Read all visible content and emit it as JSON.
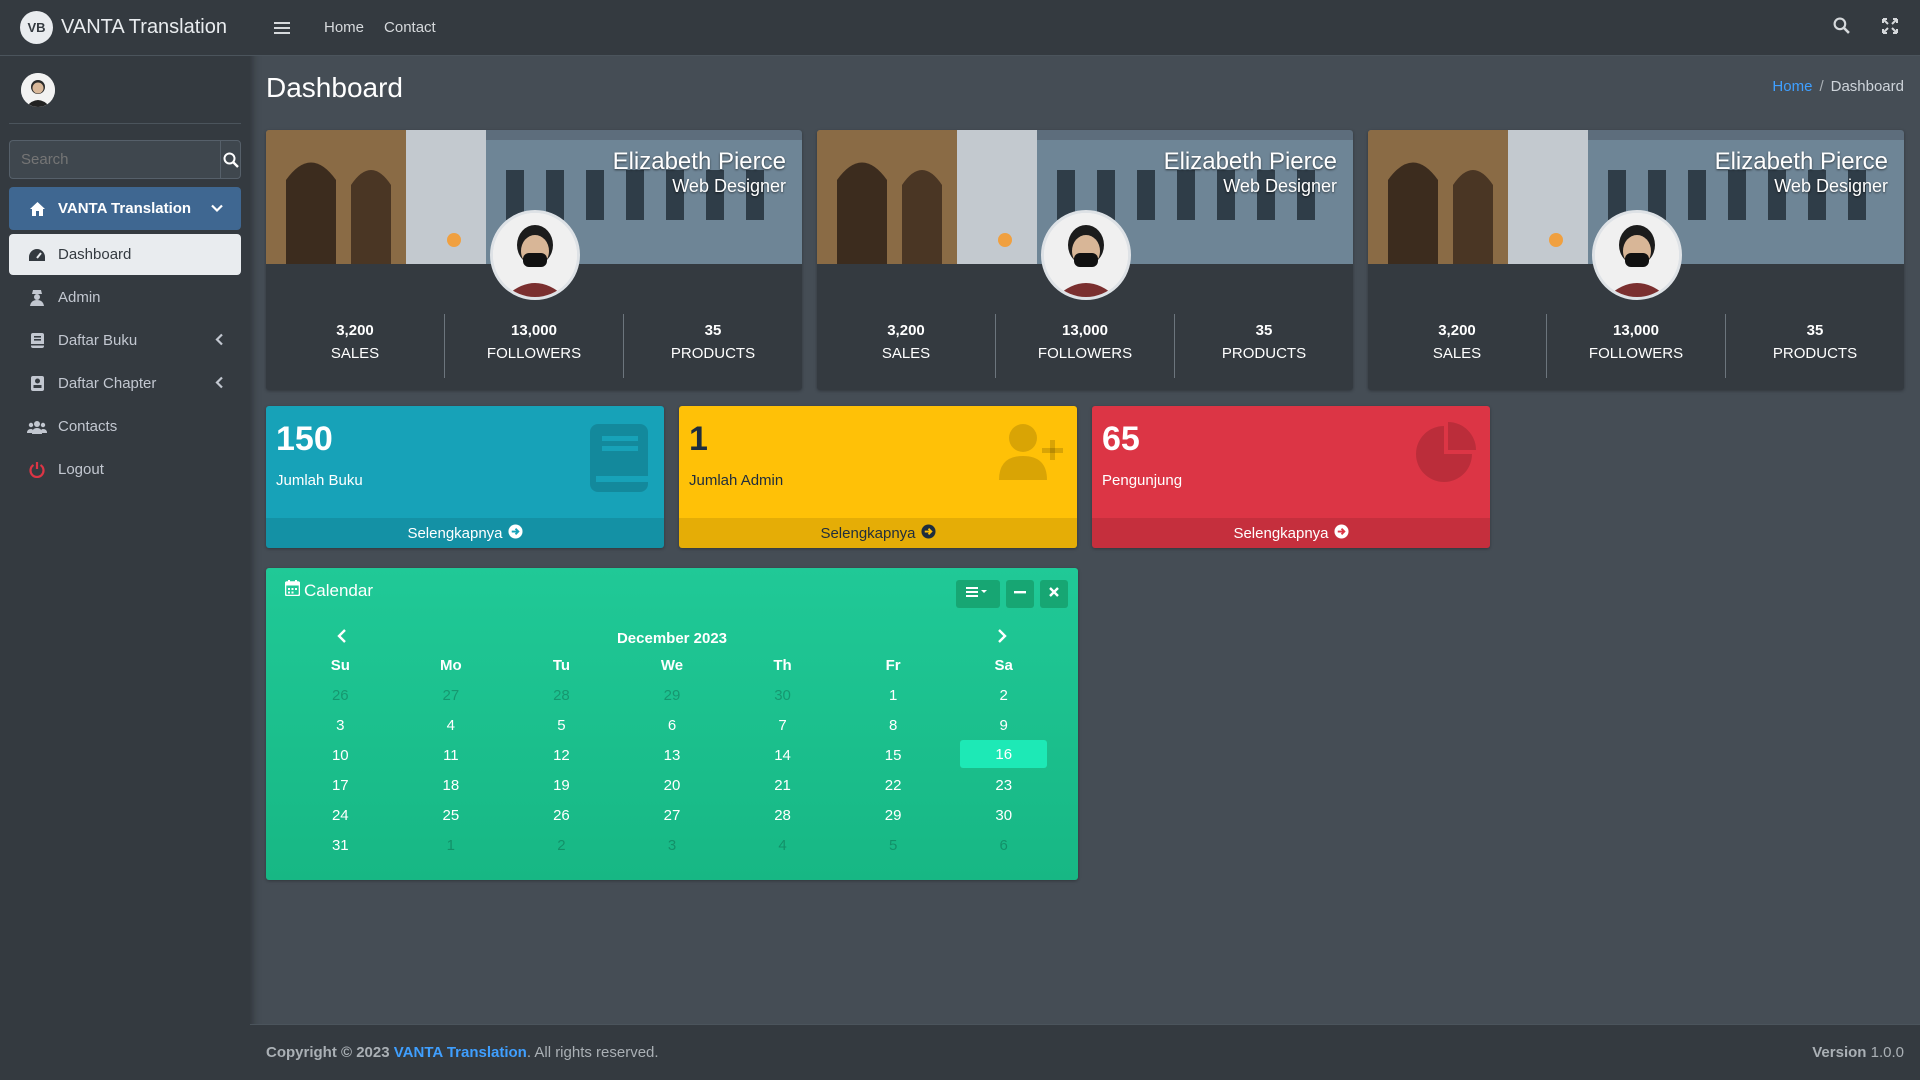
{
  "brand": {
    "logo_text": "VB",
    "name": "VANTA Translation"
  },
  "search": {
    "placeholder": "Search"
  },
  "sidebar": {
    "items": [
      {
        "label": "VANTA Translation",
        "icon": "home-icon"
      },
      {
        "label": "Dashboard",
        "icon": "dashboard-icon"
      },
      {
        "label": "Admin",
        "icon": "user-secret-icon"
      },
      {
        "label": "Daftar Buku",
        "icon": "book-icon"
      },
      {
        "label": "Daftar Chapter",
        "icon": "book-reader-icon"
      },
      {
        "label": "Contacts",
        "icon": "users-icon"
      },
      {
        "label": "Logout",
        "icon": "power-icon"
      }
    ]
  },
  "topnav": {
    "home": "Home",
    "contact": "Contact"
  },
  "header": {
    "title": "Dashboard",
    "breadcrumb_home": "Home",
    "breadcrumb_sep": "/",
    "breadcrumb_current": "Dashboard"
  },
  "profiles": [
    {
      "name": "Elizabeth Pierce",
      "role": "Web Designer",
      "stats": [
        {
          "num": "3,200",
          "label": "SALES"
        },
        {
          "num": "13,000",
          "label": "FOLLOWERS"
        },
        {
          "num": "35",
          "label": "PRODUCTS"
        }
      ]
    },
    {
      "name": "Elizabeth Pierce",
      "role": "Web Designer",
      "stats": [
        {
          "num": "3,200",
          "label": "SALES"
        },
        {
          "num": "13,000",
          "label": "FOLLOWERS"
        },
        {
          "num": "35",
          "label": "PRODUCTS"
        }
      ]
    },
    {
      "name": "Elizabeth Pierce",
      "role": "Web Designer",
      "stats": [
        {
          "num": "3,200",
          "label": "SALES"
        },
        {
          "num": "13,000",
          "label": "FOLLOWERS"
        },
        {
          "num": "35",
          "label": "PRODUCTS"
        }
      ]
    }
  ],
  "boxes": [
    {
      "value": "150",
      "label": "Jumlah Buku",
      "footer": "Selengkapnya",
      "color": "#17a2b8",
      "icon": "book-icon"
    },
    {
      "value": "1",
      "label": "Jumlah Admin",
      "footer": "Selengkapnya",
      "color": "#ffc107",
      "icon": "user-plus-icon"
    },
    {
      "value": "65",
      "label": "Pengunjung",
      "footer": "Selengkapnya",
      "color": "#dc3545",
      "icon": "pie-chart-icon"
    }
  ],
  "calendar": {
    "title": "Calendar",
    "month": "December 2023",
    "days": [
      "Su",
      "Mo",
      "Tu",
      "We",
      "Th",
      "Fr",
      "Sa"
    ],
    "weeks": [
      [
        "26",
        "27",
        "28",
        "29",
        "30",
        "1",
        "2"
      ],
      [
        "3",
        "4",
        "5",
        "6",
        "7",
        "8",
        "9"
      ],
      [
        "10",
        "11",
        "12",
        "13",
        "14",
        "15",
        "16"
      ],
      [
        "17",
        "18",
        "19",
        "20",
        "21",
        "22",
        "23"
      ],
      [
        "24",
        "25",
        "26",
        "27",
        "28",
        "29",
        "30"
      ],
      [
        "31",
        "1",
        "2",
        "3",
        "4",
        "5",
        "6"
      ]
    ],
    "today": "16"
  },
  "footer": {
    "copyright": "Copyright © 2023",
    "brand": "VANTA Translation",
    "rights": ". All rights reserved.",
    "version_label": "Version",
    "version": "1.0.0"
  },
  "colors": {
    "accent": "#3f9fff",
    "sidebar_active": "#3f6791",
    "calendar": "#20c997"
  }
}
